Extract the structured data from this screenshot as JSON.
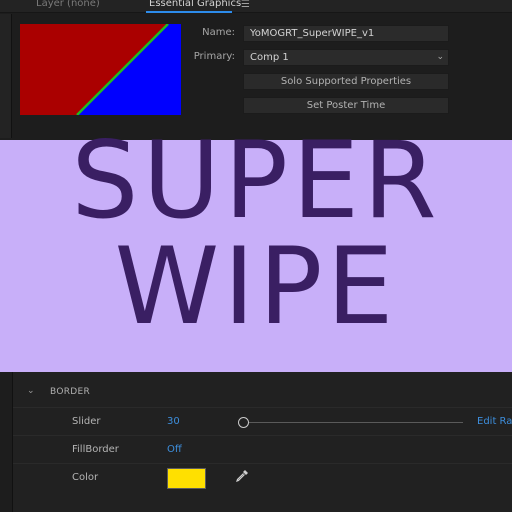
{
  "tabs": {
    "layer": "Layer (none)",
    "essential_graphics": "Essential Graphics",
    "menu_icon": "menu-icon"
  },
  "thumbnail": {
    "colors": [
      "#aa0000",
      "#0000ff",
      "#22bb22"
    ]
  },
  "fields": {
    "name_label": "Name:",
    "name_value": "YoMOGRT_SuperWIPE_v1",
    "primary_label": "Primary:",
    "primary_value": "Comp 1"
  },
  "buttons": {
    "solo": "Solo Supported Properties",
    "poster": "Set Poster Time"
  },
  "banner": {
    "line1": "SUPER",
    "line2": "WIPE",
    "background": "#c8aff9",
    "text_color": "#3a1f63"
  },
  "properties": {
    "section_title": "BORDER",
    "slider": {
      "label": "Slider",
      "value": "30",
      "position_fraction": 0.0,
      "edit_range": "Edit Ran"
    },
    "fill_border": {
      "label": "FillBorder",
      "value": "Off"
    },
    "color": {
      "label": "Color",
      "swatch": "#ffe000",
      "eyedropper_icon": "eyedropper-icon"
    }
  },
  "colors": {
    "accent": "#2d8ceb",
    "link": "#3d8edc"
  }
}
